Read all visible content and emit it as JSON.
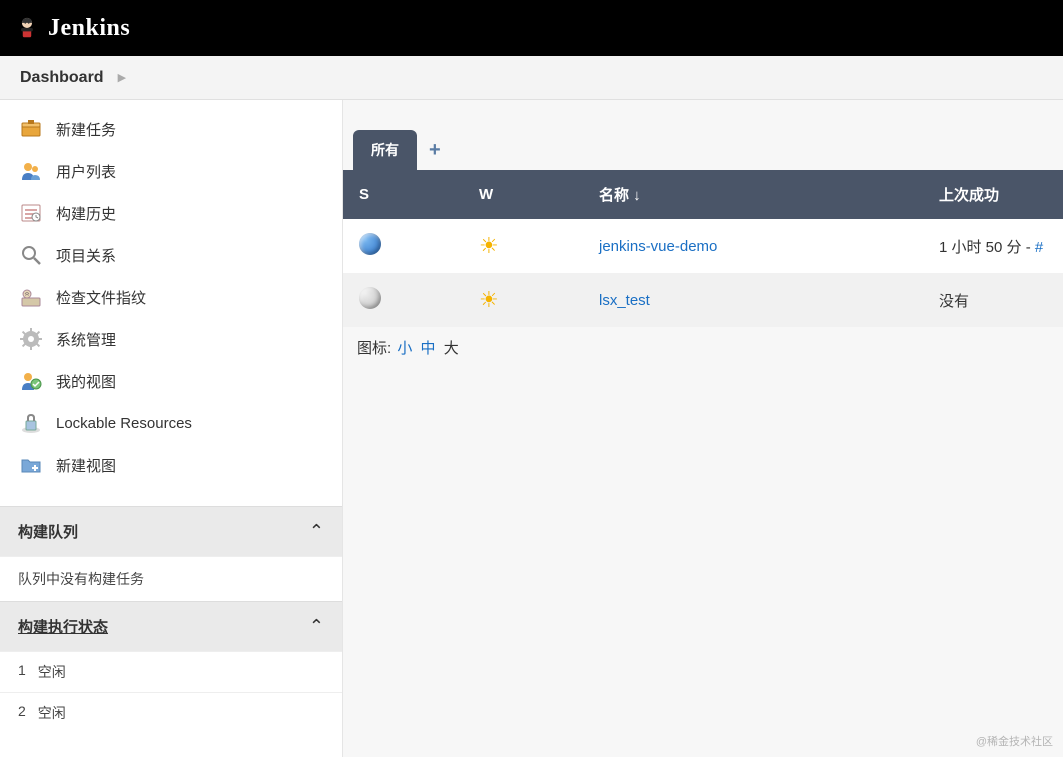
{
  "header": {
    "brand": "Jenkins"
  },
  "breadcrumbs": {
    "items": [
      "Dashboard"
    ]
  },
  "sidebar": {
    "tasks": [
      {
        "label": "新建任务",
        "icon": "new-item"
      },
      {
        "label": "用户列表",
        "icon": "people"
      },
      {
        "label": "构建历史",
        "icon": "build-history"
      },
      {
        "label": "项目关系",
        "icon": "relations"
      },
      {
        "label": "检查文件指纹",
        "icon": "fingerprint"
      },
      {
        "label": "系统管理",
        "icon": "manage"
      },
      {
        "label": "我的视图",
        "icon": "my-views"
      },
      {
        "label": "Lockable Resources",
        "icon": "lock"
      },
      {
        "label": "新建视图",
        "icon": "new-view"
      }
    ],
    "buildQueue": {
      "title": "构建队列",
      "empty": "队列中没有构建任务"
    },
    "executors": {
      "title": "构建执行状态",
      "rows": [
        {
          "num": "1",
          "status": "空闲"
        },
        {
          "num": "2",
          "status": "空闲"
        }
      ]
    }
  },
  "main": {
    "tabs": {
      "active": "所有"
    },
    "columns": {
      "s": "S",
      "w": "W",
      "name": "名称 ↓",
      "lastSuccess": "上次成功"
    },
    "jobs": [
      {
        "status": "blue",
        "weather": "sunny",
        "name": "jenkins-vue-demo",
        "lastSuccess": "1 小时 50 分 - ",
        "build": "#"
      },
      {
        "status": "grey",
        "weather": "sunny",
        "name": "lsx_test",
        "lastSuccess": "没有",
        "build": ""
      }
    ],
    "iconSize": {
      "label": "图标:",
      "small": "小",
      "medium": "中",
      "large": "大"
    }
  },
  "watermark": "@稀金技术社区"
}
